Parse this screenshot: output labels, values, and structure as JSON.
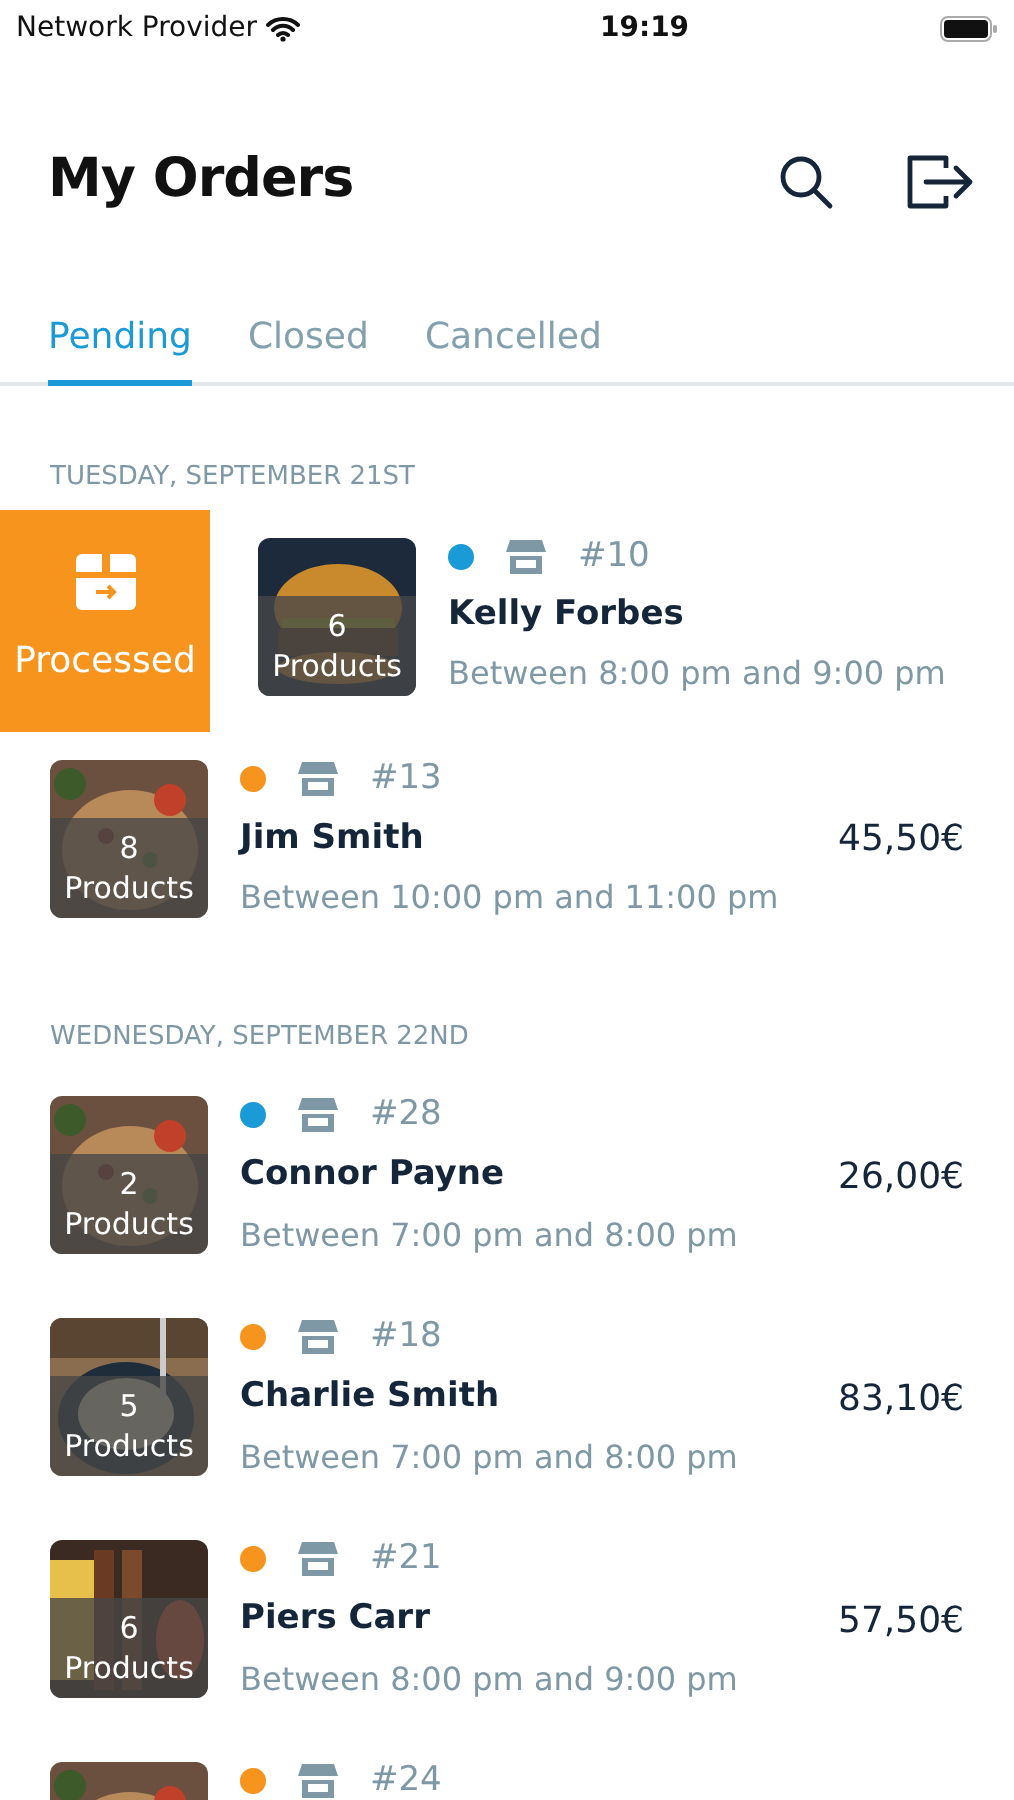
{
  "status_bar": {
    "carrier": "Network Provider",
    "time": "19:19"
  },
  "header": {
    "title": "My Orders"
  },
  "tabs": [
    {
      "label": "Pending",
      "selected": true
    },
    {
      "label": "Closed",
      "selected": false
    },
    {
      "label": "Cancelled",
      "selected": false
    }
  ],
  "sections": [
    {
      "date": "TUESDAY, SEPTEMBER 21ST",
      "orders": [
        {
          "number": "#10",
          "color": "#1a9ad6",
          "customer": "Kelly Forbes",
          "time_window": "Between 8:00 pm and 9:00 pm",
          "products": "6",
          "products_label": "Products",
          "swiped": true,
          "swipe_action": "Processed"
        },
        {
          "number": "#13",
          "color": "#f7941d",
          "customer": "Jim Smith",
          "time_window": "Between 10:00 pm and 11:00 pm",
          "products": "8",
          "products_label": "Products",
          "price": "45,50€",
          "swiped": false
        }
      ]
    },
    {
      "date": "WEDNESDAY, SEPTEMBER 22ND",
      "orders": [
        {
          "number": "#28",
          "color": "#1a9ad6",
          "customer": "Connor Payne",
          "time_window": "Between 7:00 pm and 8:00 pm",
          "products": "2",
          "products_label": "Products",
          "price": "26,00€",
          "swiped": false
        },
        {
          "number": "#18",
          "color": "#f7941d",
          "customer": "Charlie Smith",
          "time_window": "Between 7:00 pm and 8:00 pm",
          "products": "5",
          "products_label": "Products",
          "price": "83,10€",
          "swiped": false
        },
        {
          "number": "#21",
          "color": "#f7941d",
          "customer": "Piers Carr",
          "time_window": "Between 8:00 pm and 9:00 pm",
          "products": "6",
          "products_label": "Products",
          "price": "57,50€",
          "swiped": false
        },
        {
          "number": "#24",
          "color": "#f7941d",
          "swiped": false
        }
      ]
    }
  ]
}
